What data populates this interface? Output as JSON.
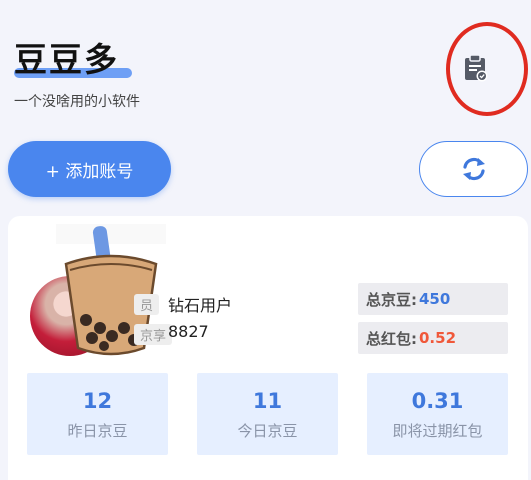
{
  "app": {
    "title": "豆豆多",
    "subtitle": "一个没啥用的小软件"
  },
  "toolbar": {
    "add_account_label": "+ 添加账号",
    "clipboard_icon": "clipboard-icon",
    "refresh_icon": "refresh-icon"
  },
  "account": {
    "level_label": "员",
    "level_value": "钻石用户",
    "id_label": "京享",
    "id_value": "8827",
    "total_beans_label": "总京豆:",
    "total_beans_value": "450",
    "total_redpacket_label": "总红包:",
    "total_redpacket_value": "0.52"
  },
  "stats": [
    {
      "value": "12",
      "label": "昨日京豆"
    },
    {
      "value": "11",
      "label": "今日京豆"
    },
    {
      "value": "0.31",
      "label": "即将过期红包"
    }
  ],
  "colors": {
    "accent": "#4a86ee",
    "beans": "#3f78dc",
    "redpacket": "#f0583a",
    "highlight_ring": "#e02b20"
  }
}
